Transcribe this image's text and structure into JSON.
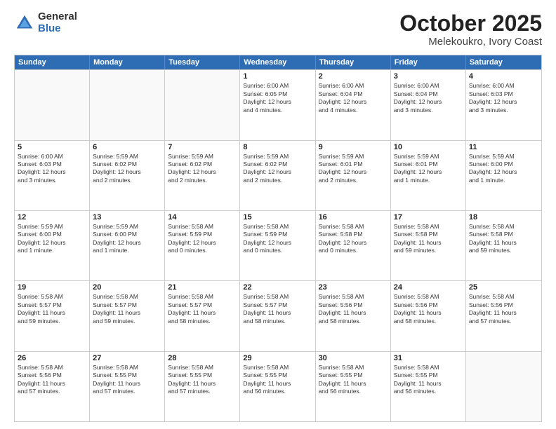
{
  "header": {
    "logo_general": "General",
    "logo_blue": "Blue",
    "title": "October 2025",
    "subtitle": "Melekoukro, Ivory Coast"
  },
  "calendar": {
    "days_of_week": [
      "Sunday",
      "Monday",
      "Tuesday",
      "Wednesday",
      "Thursday",
      "Friday",
      "Saturday"
    ],
    "rows": [
      [
        {
          "day": "",
          "info": ""
        },
        {
          "day": "",
          "info": ""
        },
        {
          "day": "",
          "info": ""
        },
        {
          "day": "1",
          "info": "Sunrise: 6:00 AM\nSunset: 6:05 PM\nDaylight: 12 hours\nand 4 minutes."
        },
        {
          "day": "2",
          "info": "Sunrise: 6:00 AM\nSunset: 6:04 PM\nDaylight: 12 hours\nand 4 minutes."
        },
        {
          "day": "3",
          "info": "Sunrise: 6:00 AM\nSunset: 6:04 PM\nDaylight: 12 hours\nand 3 minutes."
        },
        {
          "day": "4",
          "info": "Sunrise: 6:00 AM\nSunset: 6:03 PM\nDaylight: 12 hours\nand 3 minutes."
        }
      ],
      [
        {
          "day": "5",
          "info": "Sunrise: 6:00 AM\nSunset: 6:03 PM\nDaylight: 12 hours\nand 3 minutes."
        },
        {
          "day": "6",
          "info": "Sunrise: 5:59 AM\nSunset: 6:02 PM\nDaylight: 12 hours\nand 2 minutes."
        },
        {
          "day": "7",
          "info": "Sunrise: 5:59 AM\nSunset: 6:02 PM\nDaylight: 12 hours\nand 2 minutes."
        },
        {
          "day": "8",
          "info": "Sunrise: 5:59 AM\nSunset: 6:02 PM\nDaylight: 12 hours\nand 2 minutes."
        },
        {
          "day": "9",
          "info": "Sunrise: 5:59 AM\nSunset: 6:01 PM\nDaylight: 12 hours\nand 2 minutes."
        },
        {
          "day": "10",
          "info": "Sunrise: 5:59 AM\nSunset: 6:01 PM\nDaylight: 12 hours\nand 1 minute."
        },
        {
          "day": "11",
          "info": "Sunrise: 5:59 AM\nSunset: 6:00 PM\nDaylight: 12 hours\nand 1 minute."
        }
      ],
      [
        {
          "day": "12",
          "info": "Sunrise: 5:59 AM\nSunset: 6:00 PM\nDaylight: 12 hours\nand 1 minute."
        },
        {
          "day": "13",
          "info": "Sunrise: 5:59 AM\nSunset: 6:00 PM\nDaylight: 12 hours\nand 1 minute."
        },
        {
          "day": "14",
          "info": "Sunrise: 5:58 AM\nSunset: 5:59 PM\nDaylight: 12 hours\nand 0 minutes."
        },
        {
          "day": "15",
          "info": "Sunrise: 5:58 AM\nSunset: 5:59 PM\nDaylight: 12 hours\nand 0 minutes."
        },
        {
          "day": "16",
          "info": "Sunrise: 5:58 AM\nSunset: 5:58 PM\nDaylight: 12 hours\nand 0 minutes."
        },
        {
          "day": "17",
          "info": "Sunrise: 5:58 AM\nSunset: 5:58 PM\nDaylight: 11 hours\nand 59 minutes."
        },
        {
          "day": "18",
          "info": "Sunrise: 5:58 AM\nSunset: 5:58 PM\nDaylight: 11 hours\nand 59 minutes."
        }
      ],
      [
        {
          "day": "19",
          "info": "Sunrise: 5:58 AM\nSunset: 5:57 PM\nDaylight: 11 hours\nand 59 minutes."
        },
        {
          "day": "20",
          "info": "Sunrise: 5:58 AM\nSunset: 5:57 PM\nDaylight: 11 hours\nand 59 minutes."
        },
        {
          "day": "21",
          "info": "Sunrise: 5:58 AM\nSunset: 5:57 PM\nDaylight: 11 hours\nand 58 minutes."
        },
        {
          "day": "22",
          "info": "Sunrise: 5:58 AM\nSunset: 5:57 PM\nDaylight: 11 hours\nand 58 minutes."
        },
        {
          "day": "23",
          "info": "Sunrise: 5:58 AM\nSunset: 5:56 PM\nDaylight: 11 hours\nand 58 minutes."
        },
        {
          "day": "24",
          "info": "Sunrise: 5:58 AM\nSunset: 5:56 PM\nDaylight: 11 hours\nand 58 minutes."
        },
        {
          "day": "25",
          "info": "Sunrise: 5:58 AM\nSunset: 5:56 PM\nDaylight: 11 hours\nand 57 minutes."
        }
      ],
      [
        {
          "day": "26",
          "info": "Sunrise: 5:58 AM\nSunset: 5:56 PM\nDaylight: 11 hours\nand 57 minutes."
        },
        {
          "day": "27",
          "info": "Sunrise: 5:58 AM\nSunset: 5:55 PM\nDaylight: 11 hours\nand 57 minutes."
        },
        {
          "day": "28",
          "info": "Sunrise: 5:58 AM\nSunset: 5:55 PM\nDaylight: 11 hours\nand 57 minutes."
        },
        {
          "day": "29",
          "info": "Sunrise: 5:58 AM\nSunset: 5:55 PM\nDaylight: 11 hours\nand 56 minutes."
        },
        {
          "day": "30",
          "info": "Sunrise: 5:58 AM\nSunset: 5:55 PM\nDaylight: 11 hours\nand 56 minutes."
        },
        {
          "day": "31",
          "info": "Sunrise: 5:58 AM\nSunset: 5:55 PM\nDaylight: 11 hours\nand 56 minutes."
        },
        {
          "day": "",
          "info": ""
        }
      ]
    ]
  }
}
